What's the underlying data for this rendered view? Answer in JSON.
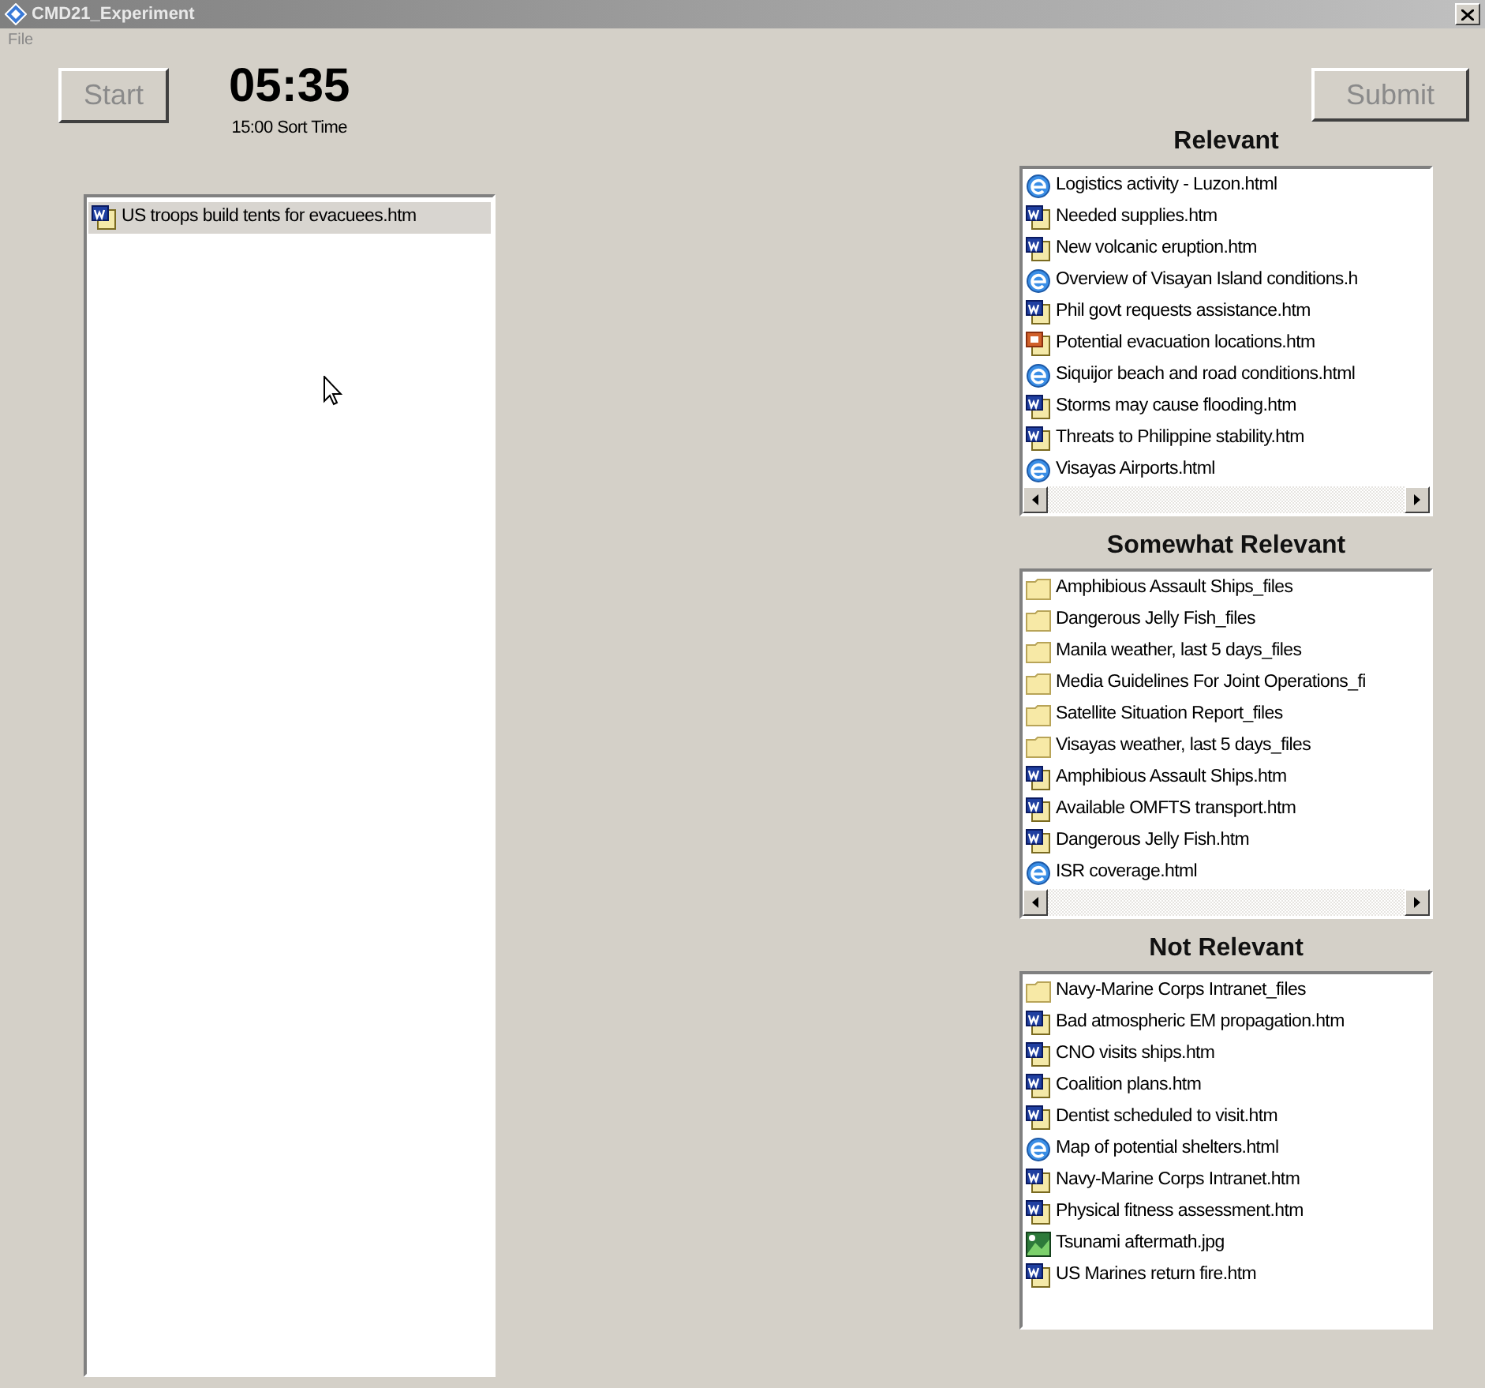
{
  "window": {
    "title": "CMD21_Experiment"
  },
  "menu": [
    "File"
  ],
  "start_button": {
    "label": "Start",
    "disabled": true
  },
  "timer": {
    "value": "05:35",
    "caption": "15:00 Sort Time"
  },
  "submit_button": {
    "label": "Submit",
    "disabled": true
  },
  "unsorted": {
    "items": [
      {
        "kind": "word",
        "label": "US troops build tents for evacuees.htm",
        "selected": true
      }
    ]
  },
  "categories": [
    {
      "title": "Relevant",
      "scrollbar": true,
      "items": [
        {
          "kind": "web",
          "label": "Logistics activity - Luzon.html",
          "selected": false
        },
        {
          "kind": "word",
          "label": "Needed supplies.htm",
          "selected": false
        },
        {
          "kind": "word",
          "label": "New volcanic eruption.htm",
          "selected": false
        },
        {
          "kind": "web",
          "label": "Overview of Visayan Island conditions.h",
          "selected": false
        },
        {
          "kind": "word",
          "label": "Phil govt requests assistance.htm",
          "selected": false
        },
        {
          "kind": "slides",
          "label": "Potential evacuation locations.htm",
          "selected": false
        },
        {
          "kind": "web",
          "label": "Siquijor beach and road conditions.html",
          "selected": false
        },
        {
          "kind": "word",
          "label": "Storms may cause flooding.htm",
          "selected": false
        },
        {
          "kind": "word",
          "label": "Threats to Philippine stability.htm",
          "selected": false
        },
        {
          "kind": "web",
          "label": "Visayas Airports.html",
          "selected": false
        }
      ]
    },
    {
      "title": "Somewhat Relevant",
      "scrollbar": true,
      "items": [
        {
          "kind": "folder",
          "label": "Amphibious Assault Ships_files",
          "selected": false
        },
        {
          "kind": "folder",
          "label": "Dangerous Jelly Fish_files",
          "selected": false
        },
        {
          "kind": "folder",
          "label": "Manila weather, last 5 days_files",
          "selected": false
        },
        {
          "kind": "folder",
          "label": "Media Guidelines For Joint Operations_fi",
          "selected": false
        },
        {
          "kind": "folder",
          "label": "Satellite Situation Report_files",
          "selected": false
        },
        {
          "kind": "folder",
          "label": "Visayas weather, last 5 days_files",
          "selected": false
        },
        {
          "kind": "word",
          "label": "Amphibious Assault Ships.htm",
          "selected": false
        },
        {
          "kind": "word",
          "label": "Available OMFTS transport.htm",
          "selected": false
        },
        {
          "kind": "word",
          "label": "Dangerous Jelly Fish.htm",
          "selected": false
        },
        {
          "kind": "web",
          "label": "ISR coverage.html",
          "selected": false
        }
      ]
    },
    {
      "title": "Not Relevant",
      "scrollbar": false,
      "items": [
        {
          "kind": "folder",
          "label": "Navy-Marine Corps Intranet_files",
          "selected": false
        },
        {
          "kind": "word",
          "label": "Bad atmospheric EM propagation.htm",
          "selected": false
        },
        {
          "kind": "word",
          "label": "CNO visits ships.htm",
          "selected": false
        },
        {
          "kind": "word",
          "label": "Coalition plans.htm",
          "selected": false
        },
        {
          "kind": "word",
          "label": "Dentist scheduled to visit.htm",
          "selected": false
        },
        {
          "kind": "web",
          "label": "Map of potential shelters.html",
          "selected": false
        },
        {
          "kind": "word",
          "label": "Navy-Marine Corps Intranet.htm",
          "selected": false
        },
        {
          "kind": "word",
          "label": "Physical fitness assessment.htm",
          "selected": false
        },
        {
          "kind": "image",
          "label": "Tsunami aftermath.jpg",
          "selected": false
        },
        {
          "kind": "word",
          "label": "US Marines return fire.htm",
          "selected": false
        }
      ]
    }
  ]
}
